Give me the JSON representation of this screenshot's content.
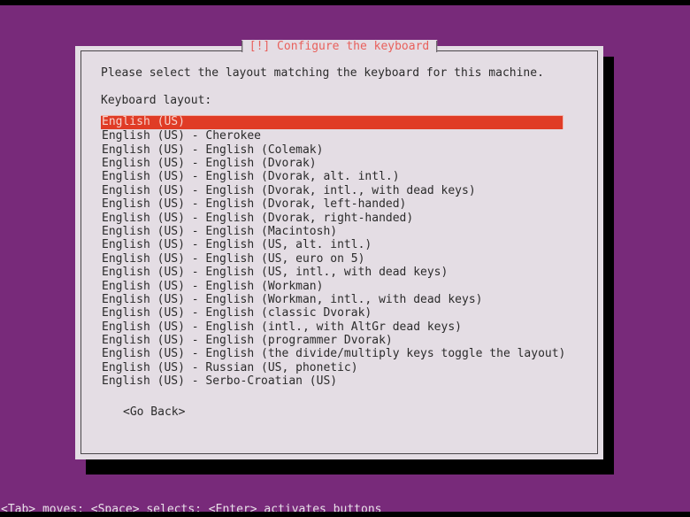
{
  "colors": {
    "console_background": "#782a7a",
    "dialog_background": "#e4dde4",
    "dialog_border": "#4a464a",
    "title_text": "#e8615c",
    "selection_background": "#e03c26",
    "selection_text": "#f6d4ce",
    "body_text": "#2b2b2b",
    "help_bar_text": "#e9e1e9",
    "shadow": "#000000"
  },
  "dialog": {
    "title": "[!] Configure the keyboard",
    "prompt": "Please select the layout matching the keyboard for this machine.",
    "field_label": "Keyboard layout:",
    "selected_index": 0,
    "go_back_label": "<Go Back>",
    "items": [
      "English (US)",
      "English (US) - Cherokee",
      "English (US) - English (Colemak)",
      "English (US) - English (Dvorak)",
      "English (US) - English (Dvorak, alt. intl.)",
      "English (US) - English (Dvorak, intl., with dead keys)",
      "English (US) - English (Dvorak, left-handed)",
      "English (US) - English (Dvorak, right-handed)",
      "English (US) - English (Macintosh)",
      "English (US) - English (US, alt. intl.)",
      "English (US) - English (US, euro on 5)",
      "English (US) - English (US, intl., with dead keys)",
      "English (US) - English (Workman)",
      "English (US) - English (Workman, intl., with dead keys)",
      "English (US) - English (classic Dvorak)",
      "English (US) - English (intl., with AltGr dead keys)",
      "English (US) - English (programmer Dvorak)",
      "English (US) - English (the divide/multiply keys toggle the layout)",
      "English (US) - Russian (US, phonetic)",
      "English (US) - Serbo-Croatian (US)"
    ]
  },
  "help_bar": {
    "text": "<Tab> moves; <Space> selects; <Enter> activates buttons"
  }
}
